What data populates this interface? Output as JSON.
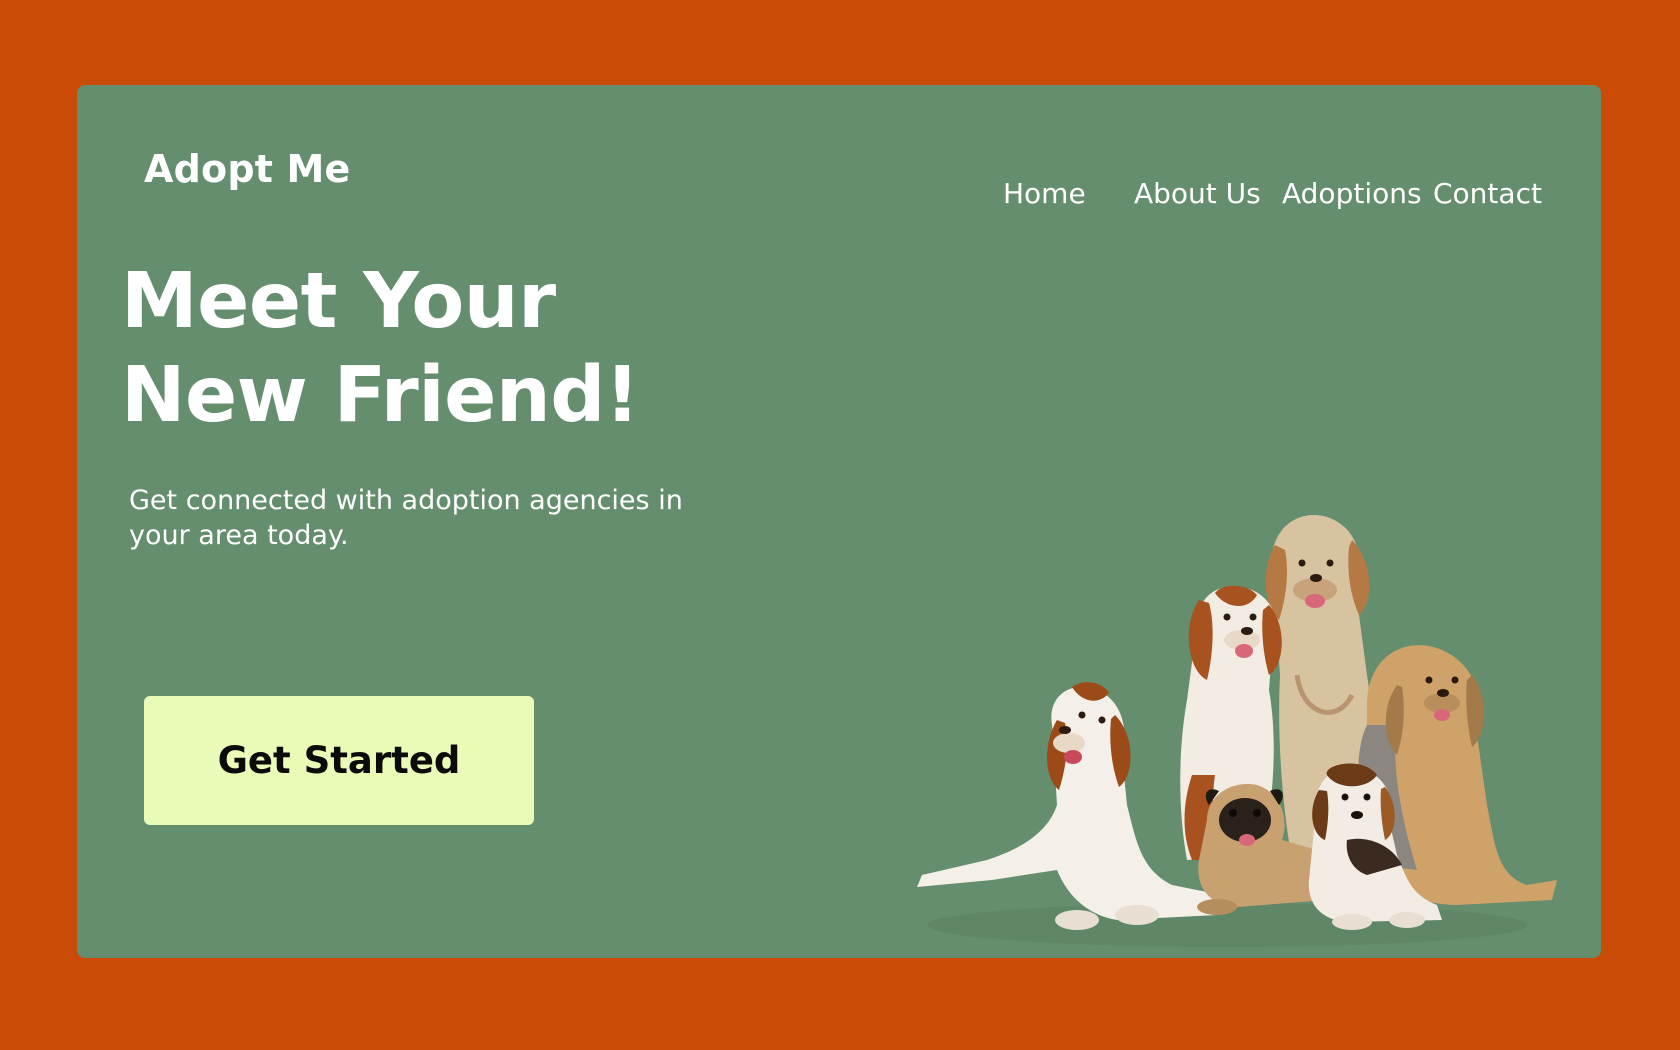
{
  "brand": {
    "name": "Adopt Me"
  },
  "nav": {
    "items": [
      "Home",
      "About Us",
      "Adoptions",
      "Contact"
    ]
  },
  "hero": {
    "title_line1": "Meet Your",
    "title_line2": "New Friend!",
    "subtitle": "Get connected with adoption agencies in your area today.",
    "cta_label": "Get Started"
  },
  "colors": {
    "page_background": "#c94b05",
    "card_background": "#648e6e",
    "cta_background": "#e9fbb6",
    "text_light": "#ffffff",
    "text_dark": "#0b0b0b"
  },
  "image": {
    "subject": "group-of-dogs"
  }
}
